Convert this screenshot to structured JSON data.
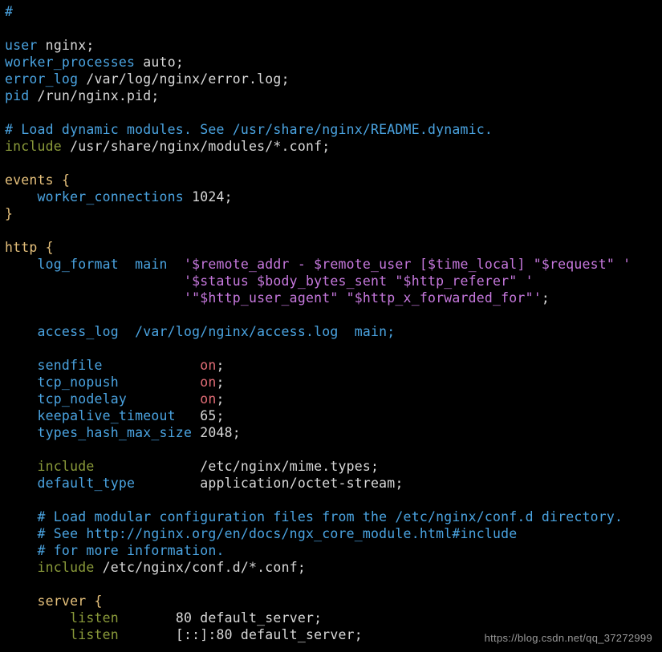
{
  "watermark": "https://blog.csdn.net/qq_37272999",
  "lines": {
    "l0": "#                                                                             ",
    "l1_user": "user",
    "l1_val": " nginx;",
    "l2_wp": "worker_processes",
    "l2_val": " auto;",
    "l3_el": "error_log",
    "l3_val": " /var/log/nginx/error.log;",
    "l4_pid": "pid",
    "l4_val": " /run/nginx.pid;",
    "l6_cmt": "# Load dynamic modules. See /usr/share/nginx/README.dynamic.",
    "l7_inc": "include",
    "l7_val": " /usr/share/nginx/modules/*.conf;",
    "l9_ev": "events",
    "l9_b": " {",
    "l10_wc": "    worker_connections",
    "l10_v": " 1024",
    "l10_s": ";",
    "l11": "}",
    "l13_http": "http",
    "l13_b": " {",
    "l14_a": "    log_format  main  ",
    "l14_s": "'$remote_addr - $remote_user [$time_local] \"$request\" '",
    "l15_s": "                      '$status $body_bytes_sent \"$http_referer\" '",
    "l16_s": "                      '\"$http_user_agent\" \"$http_x_forwarded_for\"'",
    "l16_e": ";",
    "l18_a": "    access_log  /var/log/nginx/access.log  main;",
    "l20_k": "    sendfile           ",
    "l20_v": " on",
    "l20_s": ";",
    "l21_k": "    tcp_nopush         ",
    "l21_v": " on",
    "l21_s": ";",
    "l22_k": "    tcp_nodelay        ",
    "l22_v": " on",
    "l22_s": ";",
    "l23_k": "    keepalive_timeout  ",
    "l23_v": " 65",
    "l23_s": ";",
    "l24_k": "    types_hash_max_size",
    "l24_v": " 2048",
    "l24_s": ";",
    "l26_k": "    include            ",
    "l26_v": " /etc/nginx/mime.types;",
    "l27_k": "    default_type       ",
    "l27_v": " application/octet-stream;",
    "l29": "    # Load modular configuration files from the /etc/nginx/conf.d directory.",
    "l30": "    # See http://nginx.org/en/docs/ngx_core_module.html#include",
    "l31": "    # for more information.",
    "l32_k": "    include",
    "l32_v": " /etc/nginx/conf.d/*.conf;",
    "l34_k": "    server",
    "l34_b": " {",
    "l35_k": "        listen      ",
    "l35_v": " 80",
    "l35_r": " default_server;",
    "l36_k": "        listen      ",
    "l36_v": " [::]:80",
    "l36_r": " default_server;"
  }
}
